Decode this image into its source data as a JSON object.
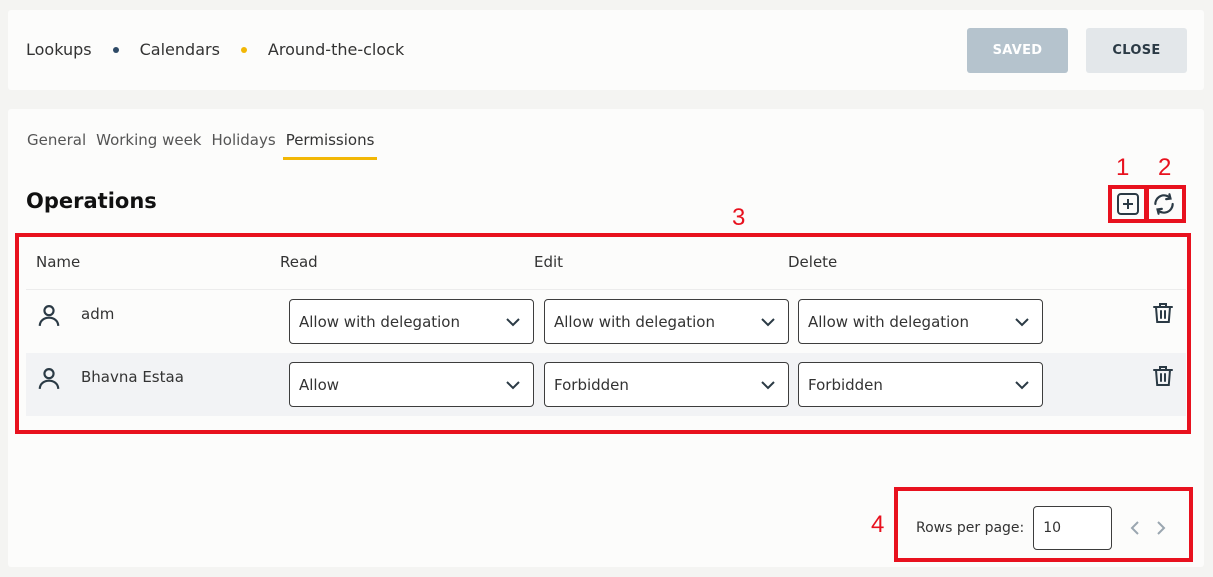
{
  "breadcrumb": {
    "items": [
      "Lookups",
      "Calendars",
      "Around-the-clock"
    ],
    "dot_colors": [
      "#2e4a66",
      "#f2b705"
    ]
  },
  "header": {
    "saved_label": "SAVED",
    "close_label": "CLOSE"
  },
  "tabs": [
    "General",
    "Working week",
    "Holidays",
    "Permissions"
  ],
  "active_tab": "Permissions",
  "section": {
    "title": "Operations"
  },
  "toolbar": {
    "add_icon": "add-square-icon",
    "refresh_icon": "refresh-icon"
  },
  "table": {
    "columns": [
      "Name",
      "Read",
      "Edit",
      "Delete"
    ],
    "rows": [
      {
        "name": "adm",
        "read": "Allow with delegation",
        "edit": "Allow with delegation",
        "delete": "Allow with delegation"
      },
      {
        "name": "Bhavna Estaa",
        "read": "Allow",
        "edit": "Forbidden",
        "delete": "Forbidden"
      }
    ]
  },
  "pagination": {
    "rows_per_page_label": "Rows per page:",
    "rows_per_page_value": "10"
  },
  "annotations": [
    "1",
    "2",
    "3",
    "4"
  ],
  "colors": {
    "accent": "#f2b705",
    "annotation": "#e8111e",
    "saved_bg": "#b5c3cd",
    "close_bg": "#e3e7ea"
  }
}
